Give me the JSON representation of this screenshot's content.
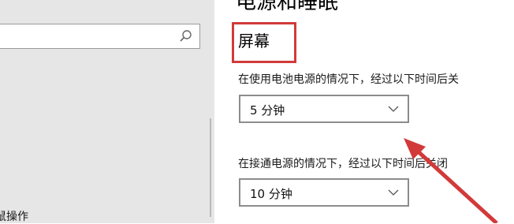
{
  "sidebar": {
    "search": {
      "placeholder": ""
    },
    "items": [
      {
        "label": "鼠操作"
      }
    ]
  },
  "main": {
    "page_title": "电源和睡眠",
    "screen_section": {
      "title": "屏幕",
      "battery_label": "在使用电池电源的情况下，经过以下时间后关",
      "battery_value": "5 分钟",
      "plugged_label": "在接通电源的情况下，经过以下时间后关闭",
      "plugged_value": "10 分钟"
    }
  },
  "colors": {
    "annotation_red": "#d23a3a",
    "sidebar_bg": "#e6e6e6"
  },
  "icons": {
    "search": "search-icon",
    "dropdown": "chevron-down-icon"
  }
}
